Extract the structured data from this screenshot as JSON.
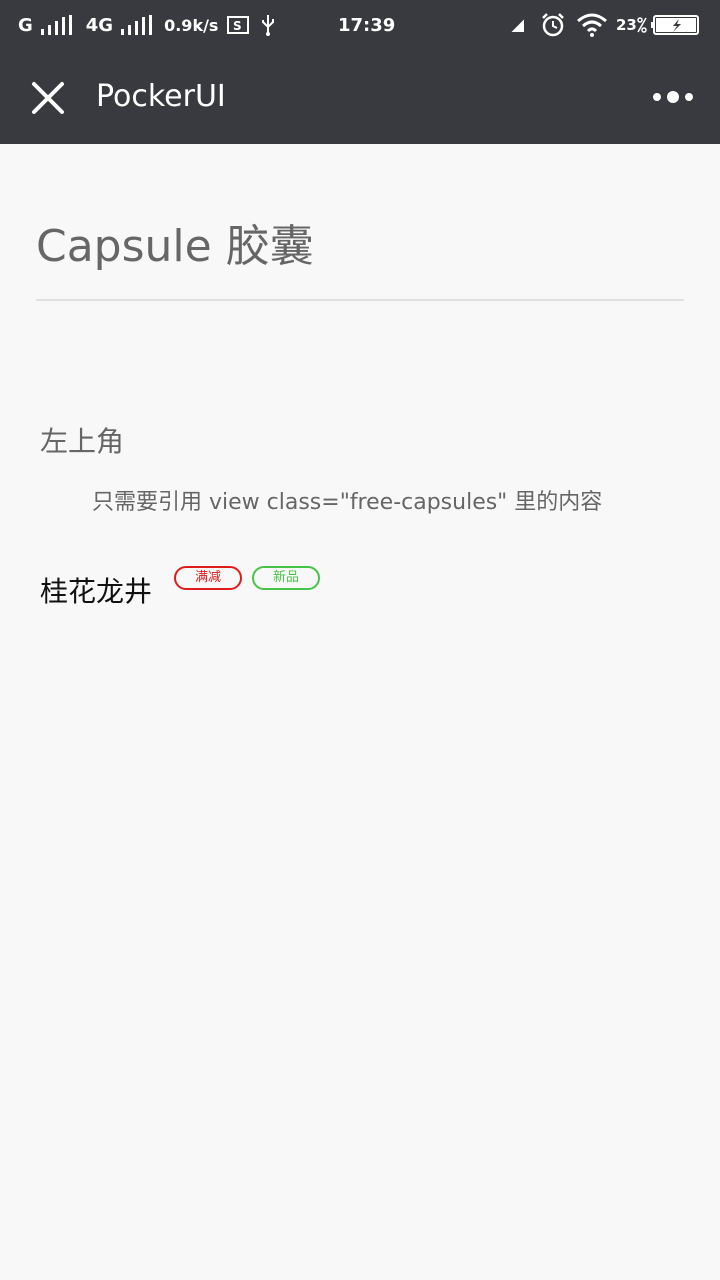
{
  "status_bar": {
    "carrier": "G",
    "network": "4G",
    "speed": "0.9k/s",
    "time": "17:39",
    "battery": "23"
  },
  "nav": {
    "title": "PockerUI"
  },
  "page": {
    "title": "Capsule 胶囊",
    "section_title": "左上角",
    "section_desc": "只需要引用 view class=\"free-capsules\" 里的内容"
  },
  "product": {
    "name": "桂花龙井",
    "tags": [
      {
        "label": "满减",
        "color": "#e01b1b"
      },
      {
        "label": "新品",
        "color": "#47c447"
      }
    ]
  }
}
